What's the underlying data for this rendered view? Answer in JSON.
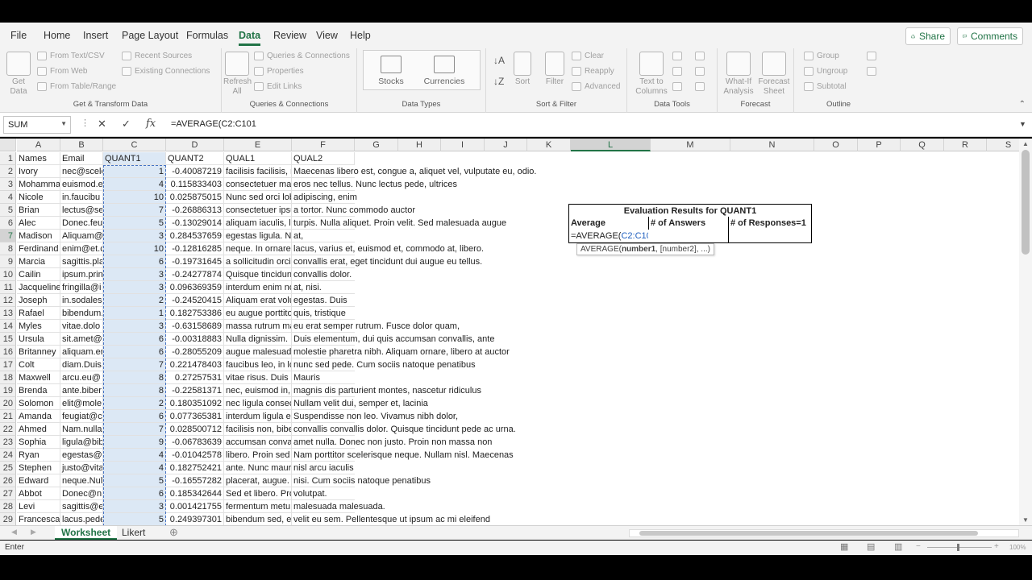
{
  "menu": {
    "tabs": [
      "File",
      "Home",
      "Insert",
      "Page Layout",
      "Formulas",
      "Data",
      "Review",
      "View",
      "Help"
    ],
    "active_tab": "Data",
    "share": "Share",
    "comments": "Comments"
  },
  "ribbon": {
    "get_transform": {
      "get_data": "Get Data",
      "from_text": "From Text/CSV",
      "from_web": "From Web",
      "from_table": "From Table/Range",
      "recent": "Recent Sources",
      "existing": "Existing Connections",
      "label": "Get & Transform Data"
    },
    "queries": {
      "refresh": "Refresh All",
      "queries_conn": "Queries & Connections",
      "properties": "Properties",
      "edit_links": "Edit Links",
      "label": "Queries & Connections"
    },
    "data_types": {
      "stocks": "Stocks",
      "currencies": "Currencies",
      "label": "Data Types"
    },
    "sort_filter": {
      "sort": "Sort",
      "filter": "Filter",
      "clear": "Clear",
      "reapply": "Reapply",
      "advanced": "Advanced",
      "label": "Sort & Filter"
    },
    "data_tools": {
      "text_to_columns": "Text to Columns",
      "label": "Data Tools"
    },
    "forecast": {
      "whatif": "What-If Analysis",
      "forecast_sheet": "Forecast Sheet",
      "label": "Forecast"
    },
    "outline": {
      "group": "Group",
      "ungroup": "Ungroup",
      "subtotal": "Subtotal",
      "label": "Outline"
    }
  },
  "formula_bar": {
    "name_box": "SUM",
    "formula": "=AVERAGE(C2:C101"
  },
  "columns": [
    "A",
    "B",
    "C",
    "D",
    "E",
    "F",
    "G",
    "H",
    "I",
    "J",
    "K",
    "L",
    "M",
    "N",
    "O",
    "P",
    "Q",
    "R",
    "S"
  ],
  "headers": {
    "A": "Names",
    "B": "Email",
    "C": "QUANT1",
    "D": "QUANT2",
    "E": "QUAL1",
    "F": "QUAL2"
  },
  "rows": [
    [
      "Ivory",
      "nec@scele",
      "1",
      "-0.40087219",
      "facilisis facilisis, n",
      "Maecenas libero est, congue a, aliquet vel, vulputate eu, odio."
    ],
    [
      "Mohamma",
      "euismod.e",
      "4",
      "0.115833403",
      "consectetuer ma",
      "eros nec tellus. Nunc lectus pede, ultrices"
    ],
    [
      "Nicole",
      "in.faucibu",
      "10",
      "0.025875015",
      "Nunc sed orci lob",
      "adipiscing, enim"
    ],
    [
      "Brian",
      "lectus@se",
      "7",
      "-0.26886313",
      "consectetuer ipsu",
      "a tortor. Nunc commodo auctor"
    ],
    [
      "Alec",
      "Donec.feu",
      "5",
      "-0.13029014",
      "aliquam iaculis, la",
      "turpis. Nulla aliquet. Proin velit. Sed malesuada augue"
    ],
    [
      "Madison",
      "Aliquam@",
      "3",
      "0.284537659",
      "egestas ligula. Nu",
      "at,"
    ],
    [
      "Ferdinand",
      "enim@et.c",
      "10",
      "-0.12816285",
      "neque. In ornare",
      "lacus, varius et, euismod et, commodo at, libero."
    ],
    [
      "Marcia",
      "sagittis.pla",
      "6",
      "-0.19731645",
      "a sollicitudin orci",
      "convallis erat, eget tincidunt dui augue eu tellus."
    ],
    [
      "Cailin",
      "ipsum.prin",
      "3",
      "-0.24277874",
      "Quisque tincidunt",
      "convallis dolor."
    ],
    [
      "Jacqueline",
      "fringilla@i",
      "3",
      "0.096369359",
      "interdum enim no",
      "at, nisi."
    ],
    [
      "Joseph",
      "in.sodales",
      "2",
      "-0.24520415",
      "Aliquam erat volu",
      "egestas. Duis"
    ],
    [
      "Rafael",
      "bibendum.",
      "1",
      "0.182753386",
      "eu augue porttito",
      "quis, tristique"
    ],
    [
      "Myles",
      "vitae.dolo",
      "3",
      "-0.63158689",
      "massa rutrum ma",
      "eu erat semper rutrum. Fusce dolor quam,"
    ],
    [
      "Ursula",
      "sit.amet@",
      "6",
      "-0.00318883",
      "Nulla dignissim. M",
      "Duis elementum, dui quis accumsan convallis, ante"
    ],
    [
      "Britanney",
      "aliquam.er",
      "6",
      "-0.28055209",
      "augue malesuada",
      "molestie pharetra nibh. Aliquam ornare, libero at auctor"
    ],
    [
      "Colt",
      "diam.Duis.",
      "7",
      "0.221478403",
      "faucibus leo, in lo",
      "nunc sed pede. Cum sociis natoque penatibus"
    ],
    [
      "Maxwell",
      "arcu.eu@",
      "8",
      "0.27257531",
      "vitae risus. Duis a",
      "Mauris"
    ],
    [
      "Brenda",
      "ante.biber",
      "8",
      "-0.22581371",
      "nec, euismod in, c",
      "magnis dis parturient montes, nascetur ridiculus"
    ],
    [
      "Solomon",
      "elit@mole",
      "2",
      "0.180351092",
      "nec ligula consec",
      "Nullam velit dui, semper et, lacinia"
    ],
    [
      "Amanda",
      "feugiat@c",
      "6",
      "0.077365381",
      "interdum ligula eu",
      "Suspendisse non leo. Vivamus nibh dolor,"
    ],
    [
      "Ahmed",
      "Nam.nulla",
      "7",
      "0.028500712",
      "facilisis non, bibe",
      "convallis convallis dolor. Quisque tincidunt pede ac urna."
    ],
    [
      "Sophia",
      "ligula@bib",
      "9",
      "-0.06783639",
      "accumsan conval",
      "amet nulla. Donec non justo. Proin non massa non"
    ],
    [
      "Ryan",
      "egestas@l",
      "4",
      "-0.01042578",
      "libero. Proin sed",
      "Nam porttitor scelerisque neque. Nullam nisl. Maecenas"
    ],
    [
      "Stephen",
      "justo@vita",
      "4",
      "0.182752421",
      "ante. Nunc maur",
      "nisl arcu iaculis"
    ],
    [
      "Edward",
      "neque.Nul",
      "5",
      "-0.16557282",
      "placerat, augue.",
      "nisi. Cum sociis natoque penatibus"
    ],
    [
      "Abbot",
      "Donec@n",
      "6",
      "0.185342644",
      "Sed et libero. Pro",
      "volutpat."
    ],
    [
      "Levi",
      "sagittis@e",
      "3",
      "0.001421755",
      "fermentum metu",
      "malesuada malesuada."
    ],
    [
      "Francesca",
      "lacus.pede",
      "5",
      "0.249397301",
      "bibendum sed, es",
      "velit eu sem. Pellentesque ut ipsum ac mi eleifend"
    ]
  ],
  "results": {
    "title": "Evaluation Results for QUANT1",
    "h_average": "Average",
    "h_answers": "# of Answers",
    "h_responses": "# of Responses=1",
    "edit_prefix": "=AVERAGE(",
    "edit_ref": "C2:C101",
    "tooltip_fn": "AVERAGE(",
    "tooltip_arg": "number1",
    "tooltip_rest": ", [number2], ...)"
  },
  "sheets": [
    "Worksheet",
    "Likert"
  ],
  "active_sheet": "Worksheet",
  "status": {
    "mode": "Enter",
    "zoom": "100%"
  }
}
